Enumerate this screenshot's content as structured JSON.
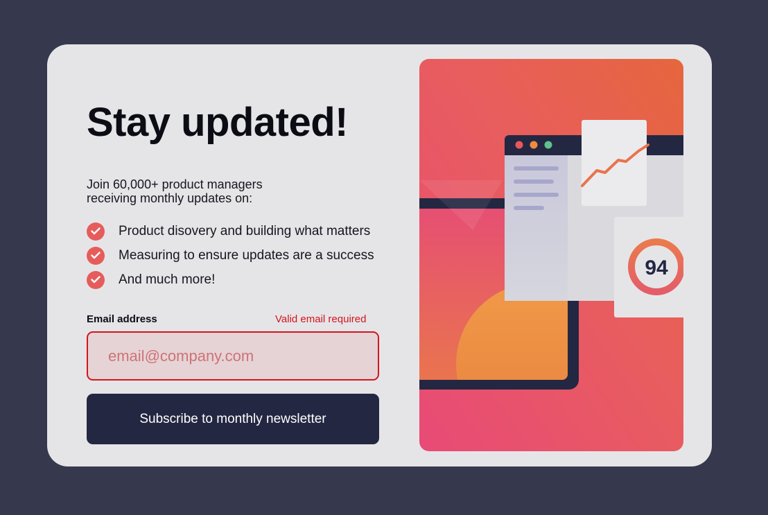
{
  "card": {
    "title": "Stay updated!",
    "intro_line1": "Join 60,000+ product managers",
    "intro_line2": "receiving monthly updates on:",
    "features": [
      "Product disovery and building what matters",
      "Measuring to ensure updates are a success",
      "And much more!"
    ]
  },
  "form": {
    "email_label": "Email address",
    "email_error": "Valid email required",
    "email_placeholder": "email@company.com",
    "email_value": "",
    "submit_label": "Subscribe to monthly newsletter"
  },
  "illustration": {
    "score": "94"
  },
  "colors": {
    "page_background": "#36384d",
    "card_background": "#e5e5e8",
    "accent_tomato": "#e65c5b",
    "error_red": "#d4141d",
    "button_navy": "#242742",
    "input_error_background": "#e6d3d5"
  }
}
